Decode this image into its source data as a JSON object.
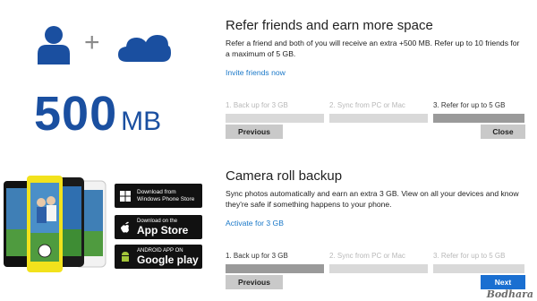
{
  "promo": {
    "storage_value": "500",
    "storage_unit": "MB",
    "plus_sign": "+",
    "person_icon": "person-icon",
    "cloud_icon": "onedrive-cloud-icon",
    "brand_color": "#1a4fa0"
  },
  "badges": {
    "windows_phone": {
      "line1": "Download from",
      "line2": "Windows Phone Store",
      "icon": "windows-icon"
    },
    "app_store": {
      "line1": "Download on the",
      "line2": "App Store",
      "icon": "apple-icon"
    },
    "google_play": {
      "line1": "ANDROID APP ON",
      "line2": "Google play",
      "icon": "android-icon"
    }
  },
  "refer": {
    "title": "Refer friends and earn more space",
    "description": "Refer a friend and both of you will receive an extra +500 MB. Refer up to 10 friends for a maximum of 5 GB.",
    "link": "Invite friends now",
    "steps": [
      {
        "label": "1. Back up for 3 GB",
        "active": false
      },
      {
        "label": "2. Sync from PC or Mac",
        "active": false
      },
      {
        "label": "3. Refer for up to 5 GB",
        "active": true
      }
    ],
    "previous_label": "Previous",
    "close_label": "Close"
  },
  "camera": {
    "title": "Camera roll backup",
    "description": "Sync photos automatically and earn an extra 3 GB. View on all your devices and know they're safe if something happens to your phone.",
    "link": "Activate for 3 GB",
    "steps": [
      {
        "label": "1. Back up for 3 GB",
        "active": true
      },
      {
        "label": "2. Sync from PC or Mac",
        "active": false
      },
      {
        "label": "3. Refer for up to 5 GB",
        "active": false
      }
    ],
    "previous_label": "Previous",
    "next_label": "Next"
  },
  "colors": {
    "link": "#1a78c8",
    "primary_button": "#1a6fd1",
    "button": "#c9c9c9",
    "step_active": "#9a9a9a",
    "step_inactive": "#d9d9d9"
  },
  "watermark": "Bodhara"
}
